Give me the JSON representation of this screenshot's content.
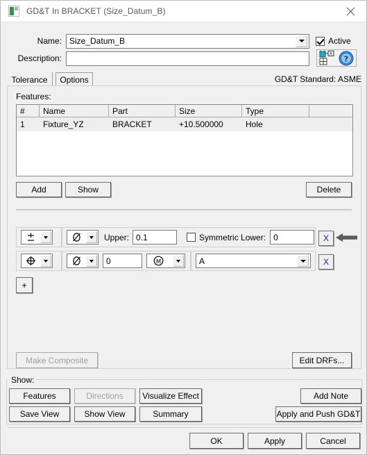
{
  "window": {
    "title": "GD&T In BRACKET (Size_Datum_B)",
    "icon": "gdt-app-icon",
    "close_label": "✕"
  },
  "header": {
    "name_label": "Name:",
    "name_value": "Size_Datum_B",
    "description_label": "Description:",
    "description_value": "",
    "active_label": "Active",
    "active_checked": true,
    "gdt_icon": "gdt-annotation-icon",
    "help_icon": "help-icon"
  },
  "tabs": {
    "items": [
      {
        "label": "Tolerance",
        "active": true
      },
      {
        "label": "Options",
        "active": false
      }
    ],
    "standard_text": "GD&T Standard: ASME"
  },
  "features": {
    "section_label": "Features:",
    "columns": [
      "#",
      "Name",
      "Part",
      "Size",
      "Type",
      ""
    ],
    "rows": [
      {
        "num": "1",
        "name": "Fixture_YZ",
        "part": "BRACKET",
        "size": "+10.500000",
        "type": "Hole",
        "extra": ""
      }
    ],
    "add_label": "Add",
    "show_label": "Show",
    "delete_label": "Delete"
  },
  "tolerance": {
    "row1": {
      "symbol": "plus-minus",
      "modifier": "diameter",
      "upper_label": "Upper:",
      "upper_value": "0.1",
      "symmetric_label": "Symmetric Lower:",
      "symmetric_checked": false,
      "lower_value": "0",
      "remove_label": "X"
    },
    "row2": {
      "symbol": "position",
      "modifier": "diameter",
      "tolerance_value": "0",
      "material_condition": "mmc",
      "datum_value": "A",
      "remove_label": "X"
    },
    "add_row_label": "+",
    "make_composite_label": "Make Composite",
    "make_composite_disabled": true,
    "edit_drfs_label": "Edit DRFs..."
  },
  "show_section": {
    "label": "Show:",
    "buttons": [
      {
        "label": "Features",
        "disabled": false
      },
      {
        "label": "Directions",
        "disabled": true
      },
      {
        "label": "Visualize Effect",
        "disabled": false
      },
      {
        "label": "Add Note",
        "disabled": false
      },
      {
        "label": "Save View",
        "disabled": false
      },
      {
        "label": "Show View",
        "disabled": false
      },
      {
        "label": "Summary",
        "disabled": false
      },
      {
        "label": "Apply and Push GD&T",
        "disabled": false
      }
    ]
  },
  "footer": {
    "ok_label": "OK",
    "apply_label": "Apply",
    "cancel_label": "Cancel"
  },
  "colors": {
    "window_bg": "#f0f0f0",
    "titlebar_bg": "#ffffff",
    "title_text": "#585858",
    "field_border": "#7a7a7a",
    "accent_blue": "#2b6cb0",
    "icon_green": "#3f8f52"
  }
}
